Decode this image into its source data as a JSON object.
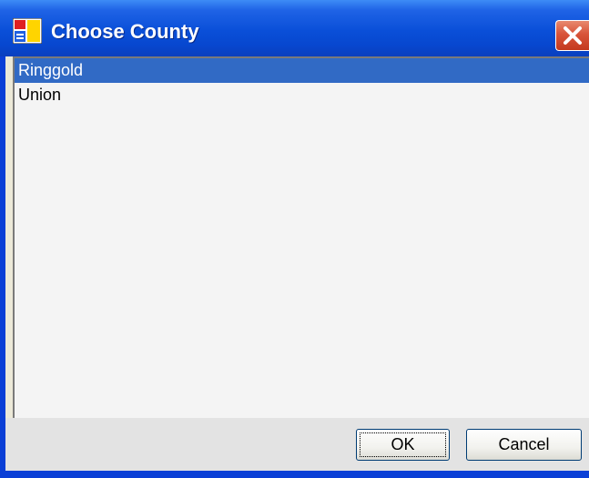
{
  "window": {
    "title": "Choose County",
    "app_icon": "windows-form-icon",
    "close_icon": "close-icon"
  },
  "listbox": {
    "items": [
      {
        "label": "Ringgold",
        "selected": true
      },
      {
        "label": "Union",
        "selected": false
      }
    ]
  },
  "buttons": {
    "ok_label": "OK",
    "cancel_label": "Cancel"
  },
  "colors": {
    "titlebar": "#0a4fd8",
    "selection": "#316ac5",
    "close_button": "#d8543a",
    "list_background": "#f4f4f4",
    "button_bar": "#e3e3e3"
  }
}
